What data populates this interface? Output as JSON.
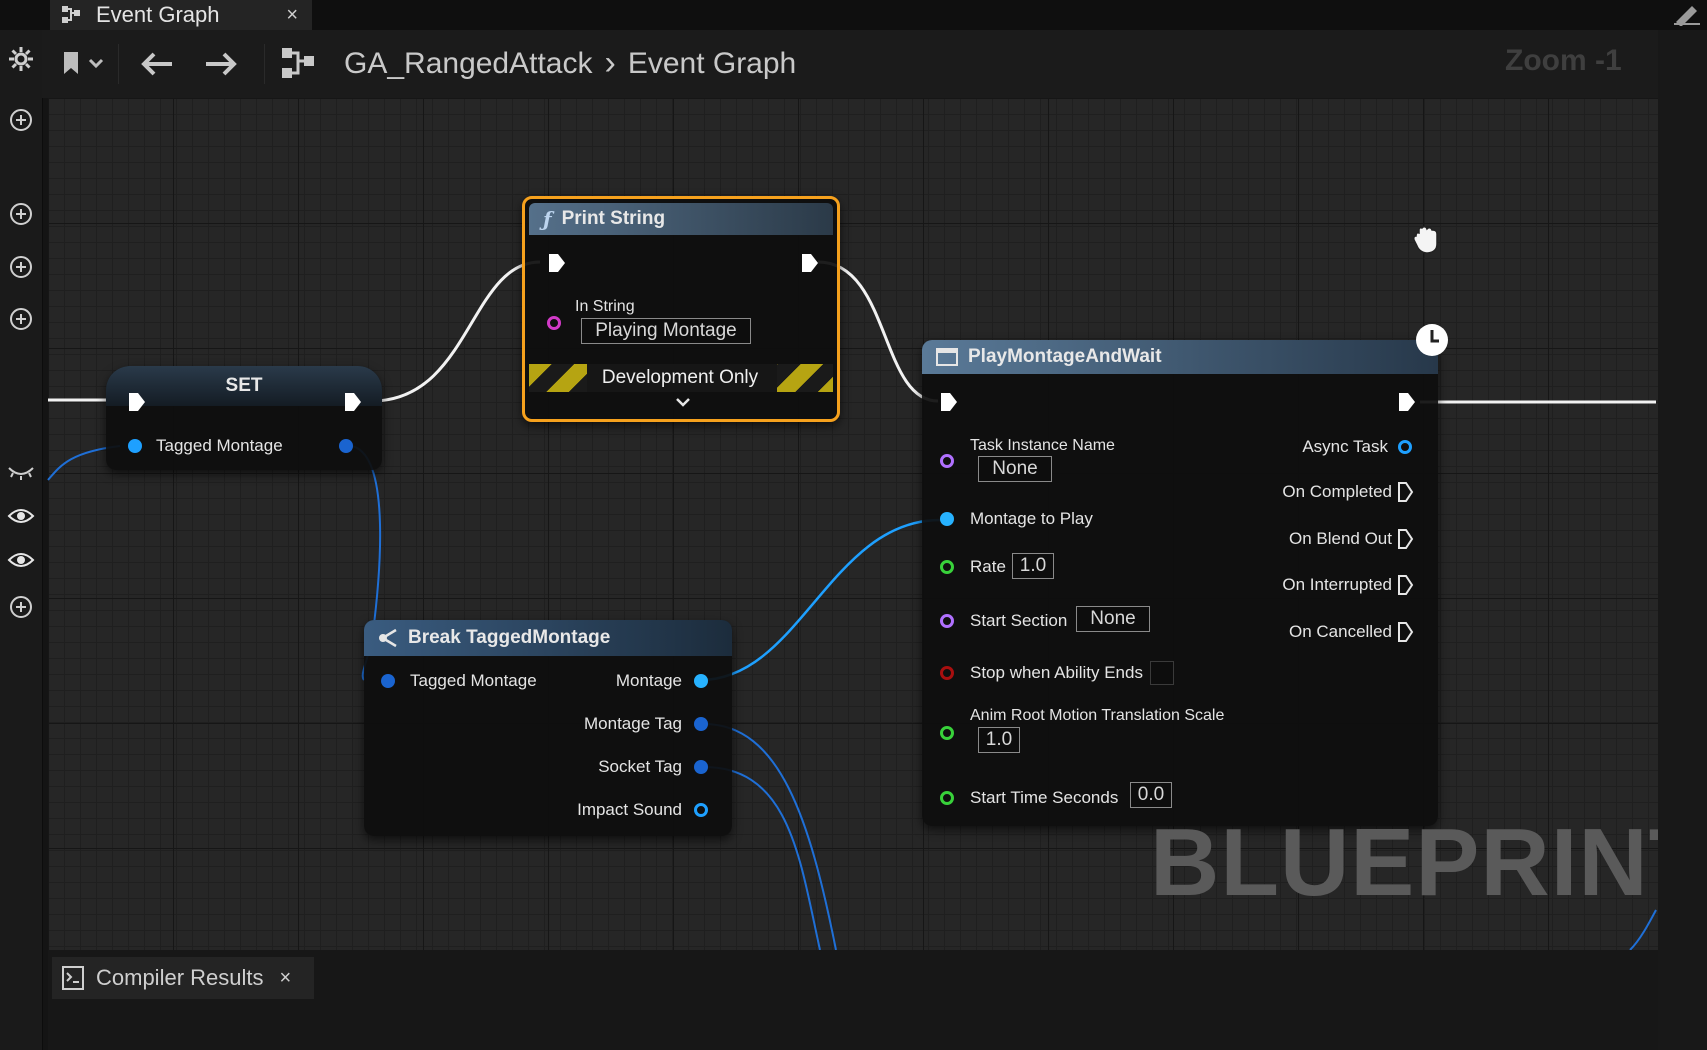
{
  "tabs": {
    "event_graph": {
      "label": "Event Graph",
      "close": "×"
    },
    "compiler": {
      "label": "Compiler Results",
      "close": "×"
    }
  },
  "breadcrumb": {
    "asset": "GA_RangedAttack",
    "separator": "›",
    "graph": "Event Graph"
  },
  "zoom": "Zoom -1",
  "watermark": "BLUEPRINT",
  "nodes": {
    "set": {
      "title": "SET",
      "pin": "Tagged Montage"
    },
    "print_string": {
      "title": "Print String",
      "in_string_label": "In String",
      "in_string_value": "Playing Montage",
      "dev_label": "Development Only"
    },
    "break": {
      "title": "Break TaggedMontage",
      "input": "Tagged Montage",
      "outputs": [
        "Montage",
        "Montage Tag",
        "Socket Tag",
        "Impact Sound"
      ]
    },
    "play_montage": {
      "title": "PlayMontageAndWait",
      "task_instance_label": "Task Instance Name",
      "task_instance_value": "None",
      "montage_label": "Montage to Play",
      "rate_label": "Rate",
      "rate_value": "1.0",
      "start_section_label": "Start Section",
      "start_section_value": "None",
      "stop_label": "Stop when Ability Ends",
      "anim_root_label": "Anim Root Motion Translation Scale",
      "anim_root_value": "1.0",
      "start_time_label": "Start Time Seconds",
      "start_time_value": "0.0",
      "outputs": [
        "Async Task",
        "On Completed",
        "On Blend Out",
        "On Interrupted",
        "On Cancelled"
      ]
    }
  },
  "icons": [
    "gear-icon",
    "bookmark-icon",
    "back-arrow-icon",
    "forward-arrow-icon",
    "blueprint-graph-icon",
    "add-icon",
    "eye-icon",
    "hand-cursor-icon",
    "latent-clock-icon"
  ],
  "colors": {
    "exec_wire": "#f2f2f2",
    "object_pin": "#1ea0ff",
    "string_pin": "#d23ac8",
    "float_pin": "#38d13a",
    "name_pin": "#b070ff",
    "bool_pin": "#a80f0f",
    "selected_border": "#f6a11d"
  }
}
